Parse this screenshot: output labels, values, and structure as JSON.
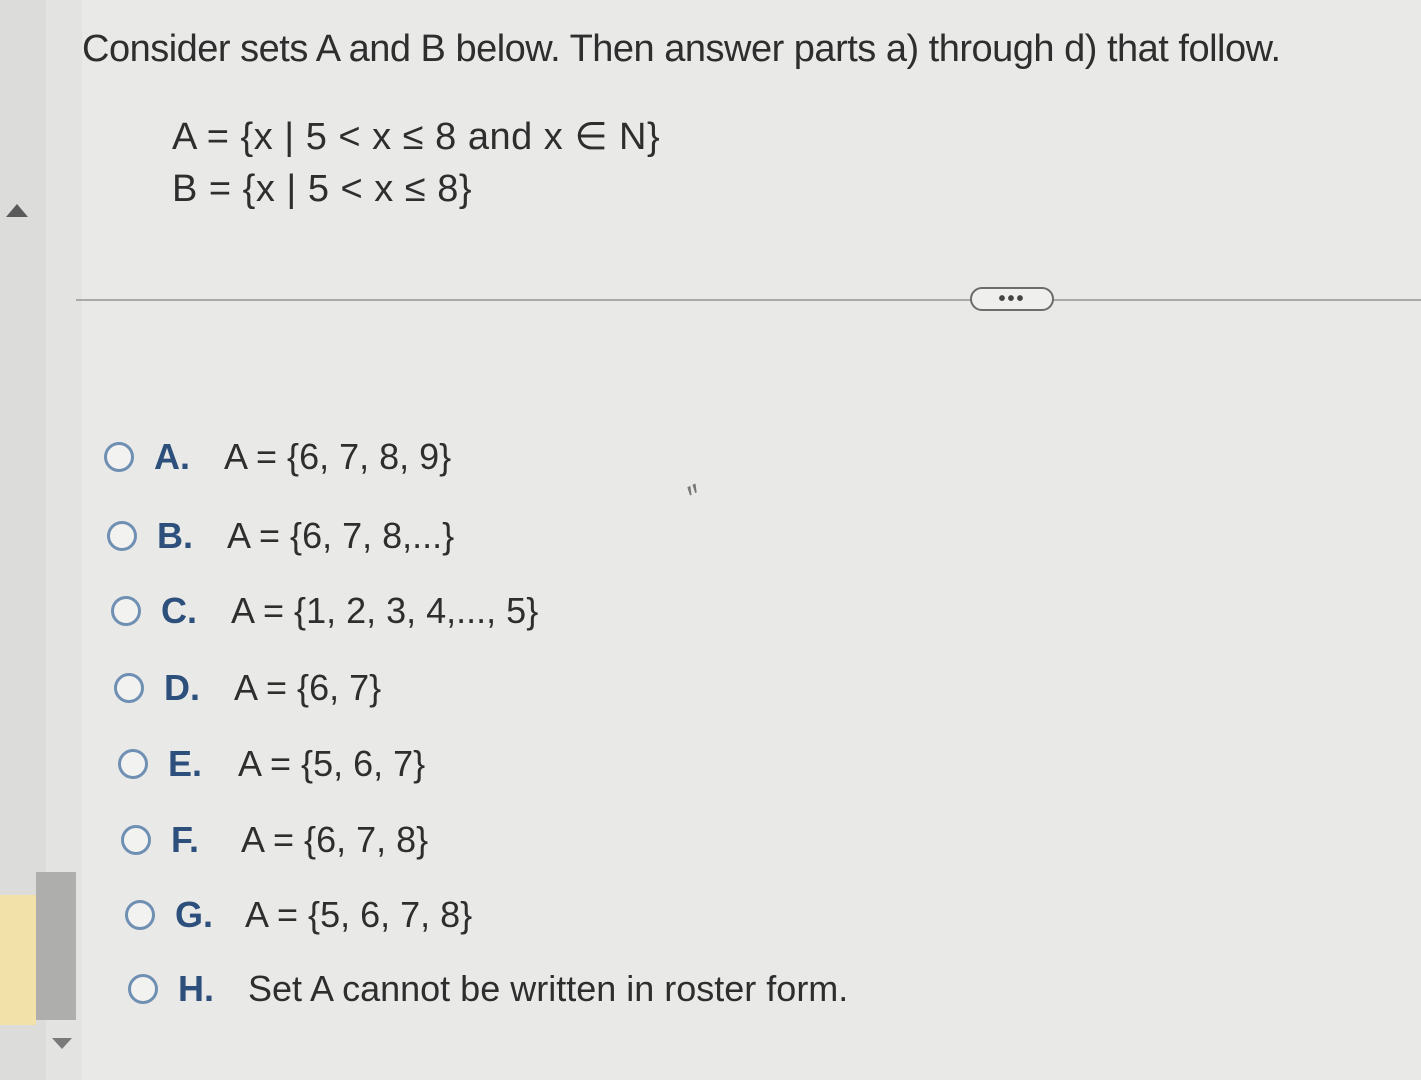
{
  "question": {
    "prompt": "Consider sets A and B below. Then answer parts a) through d) that follow.",
    "set_a": "A = {x | 5 < x ≤ 8 and x ∈ N}",
    "set_b": "B = {x | 5 < x ≤ 8}"
  },
  "more_button": {
    "label": "•••",
    "icon": "ellipsis-icon"
  },
  "options": [
    {
      "letter": "A.",
      "text": "A = {6, 7, 8, 9}"
    },
    {
      "letter": "B.",
      "text": "A = {6, 7, 8,...}"
    },
    {
      "letter": "C.",
      "text": "A = {1, 2, 3, 4,..., 5}"
    },
    {
      "letter": "D.",
      "text": "A = {6, 7}"
    },
    {
      "letter": "E.",
      "text": "A = {5, 6, 7}"
    },
    {
      "letter": "F.",
      "text": "A = {6, 7, 8}"
    },
    {
      "letter": "G.",
      "text": "A = {5, 6, 7, 8}"
    },
    {
      "letter": "H.",
      "text": "Set A cannot be written in roster form."
    }
  ],
  "colors": {
    "accent": "#2c4f7c",
    "radio_border": "#6f8fb3",
    "background": "#e9e9e8"
  }
}
